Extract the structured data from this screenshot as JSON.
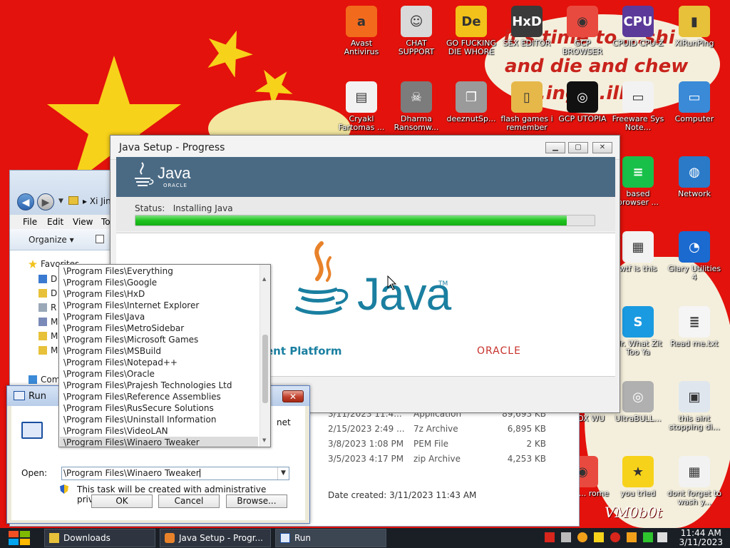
{
  "desktop": {
    "cloud_text": [
      "it's time to ...shi",
      "and die and chew",
      "...ing ...illi..."
    ],
    "watermark": "VM0b0t",
    "icons": [
      {
        "name": "avast-antivirus-icon",
        "label": "Avast Antivirus",
        "color": "#f26b1d",
        "glyph": "a"
      },
      {
        "name": "chat-support-icon",
        "label": "CHAT SUPPORT",
        "color": "#d9d9d9",
        "glyph": "☺"
      },
      {
        "name": "go-fucking-die-whore-icon",
        "label": "GO FUCKING DIE WHORE",
        "color": "#f2c21a",
        "glyph": "De"
      },
      {
        "name": "sex-editor-icon",
        "label": "SEX EDITOR",
        "color": "#3a3a3a",
        "glyph": "HxD"
      },
      {
        "name": "gcp-browser-icon",
        "label": "GCP BROWSER",
        "color": "#e94a3f",
        "glyph": "◉"
      },
      {
        "name": "cpuid-cpu-z-icon",
        "label": "CPUID CPU-Z",
        "color": "#5b3a9a",
        "glyph": "CPU"
      },
      {
        "name": "xirunping-icon",
        "label": "XiRunPing",
        "color": "#e8c13a",
        "glyph": "▮"
      },
      {
        "name": "cryakl-fartomas-icon",
        "label": "Cryakl Fartomas ...",
        "color": "#f2f2f2",
        "glyph": "▤"
      },
      {
        "name": "dharma-ransomw-icon",
        "label": "Dharma Ransomw...",
        "color": "#7c7c7c",
        "glyph": "☠"
      },
      {
        "name": "deeznutsp-icon",
        "label": "deeznutSp...",
        "color": "#9a9a9a",
        "glyph": "❐"
      },
      {
        "name": "flash-games-icon",
        "label": "flash games i remember",
        "color": "#e6b84a",
        "glyph": "▯"
      },
      {
        "name": "gcp-utopia-icon",
        "label": "GCP UTOPIA",
        "color": "#111111",
        "glyph": "◎"
      },
      {
        "name": "freeware-sys-note-icon",
        "label": "Freeware Sys Note...",
        "color": "#f2f2f2",
        "glyph": "▭"
      },
      {
        "name": "computer-icon",
        "label": "Computer",
        "color": "#3a8ad8",
        "glyph": "▭"
      },
      {
        "name": "based-browser-icon",
        "label": "based browser ...",
        "color": "#18c04a",
        "glyph": "≡"
      },
      {
        "name": "network-icon",
        "label": "Network",
        "color": "#2a7ac8",
        "glyph": "◍"
      },
      {
        "name": "wtf-is-this-icon",
        "label": "wtf is this",
        "color": "#f2f2f2",
        "glyph": "▦"
      },
      {
        "name": "glary-utilities-icon",
        "label": "Glary Utilities 4",
        "color": "#1a6ad0",
        "glyph": "◔"
      },
      {
        "name": "skype-icon",
        "label": "Mr. What Zit Too Ya",
        "color": "#1a9ae0",
        "glyph": "S"
      },
      {
        "name": "read-me-txt-icon",
        "label": "Read me.txt",
        "color": "#f5f5f5",
        "glyph": "≣"
      },
      {
        "name": "sexy-fox-wu-icon",
        "label": "XY FOX WU",
        "color": "#d03020",
        "glyph": "✦"
      },
      {
        "name": "ultrabull-icon",
        "label": "UltraBULL...",
        "color": "#b0b0b0",
        "glyph": "◎"
      },
      {
        "name": "this-aint-stopping-icon",
        "label": "this aint stopping di...",
        "color": "#dfe6ee",
        "glyph": "▣"
      },
      {
        "name": "chrome-icon",
        "label": "...mm... rome",
        "color": "#e94a3f",
        "glyph": "◉"
      },
      {
        "name": "you-tried-icon",
        "label": "you tried",
        "color": "#f7d21a",
        "glyph": "★"
      },
      {
        "name": "dont-forget-icon",
        "label": "dont forget to wash y...",
        "color": "#f2f2f2",
        "glyph": "▦"
      }
    ]
  },
  "explorer": {
    "breadcrumb": "Xi Jin",
    "menu": [
      "File",
      "Edit",
      "View",
      "To"
    ],
    "organize_label": "Organize",
    "nav": {
      "favorites": "Favorites",
      "items": [
        "D",
        "D",
        "R",
        "M",
        "M",
        "M"
      ],
      "computer": "Com"
    },
    "files": [
      {
        "date": "3/11/2023 11:4...",
        "type": "Application",
        "size": "89,693 KB"
      },
      {
        "date": "2/15/2023 2:49 ...",
        "type": "7z Archive",
        "size": "6,895 KB"
      },
      {
        "date": "3/8/2023 1:08 PM",
        "type": "PEM File",
        "size": "2 KB"
      },
      {
        "date": "3/5/2023 4:17 PM",
        "type": "zip Archive",
        "size": "4,253 KB"
      }
    ],
    "details": {
      "label": "Date created:",
      "value": "3/11/2023 11:43 AM"
    }
  },
  "java_dialog": {
    "title": "Java Setup - Progress",
    "status_label": "Status:",
    "status_value": "Installing Java",
    "progress": 0.94,
    "logo_text": "Java",
    "logo_sub": "ORACLE",
    "platform_text": "ent Platform",
    "oracle_text": "ORACLE",
    "colors": {
      "banner": "#4a6a84",
      "progress": "#1ec41e",
      "java_blue": "#1a7fa0",
      "java_orange": "#e8822a",
      "oracle_red": "#c7312a"
    }
  },
  "run_dialog": {
    "title": "Run",
    "description_partial": "net",
    "open_label": "Open:",
    "open_value": "\\Program Files\\Winaero Tweaker",
    "admin_note": "This task will be created with administrative privileges.",
    "buttons": {
      "ok": "OK",
      "cancel": "Cancel",
      "browse": "Browse..."
    }
  },
  "autocomplete": {
    "items": [
      "\\Program Files\\Everything",
      "\\Program Files\\Google",
      "\\Program Files\\HxD",
      "\\Program Files\\Internet Explorer",
      "\\Program Files\\Java",
      "\\Program Files\\MetroSidebar",
      "\\Program Files\\Microsoft Games",
      "\\Program Files\\MSBuild",
      "\\Program Files\\Notepad++",
      "\\Program Files\\Oracle",
      "\\Program Files\\Prajesh Technologies Ltd",
      "\\Program Files\\Reference Assemblies",
      "\\Program Files\\RusSecure Solutions",
      "\\Program Files\\Uninstall Information",
      "\\Program Files\\VideoLAN",
      "\\Program Files\\Winaero Tweaker"
    ],
    "selected_index": 15
  },
  "taskbar": {
    "items": [
      {
        "name": "taskbar-downloads",
        "label": "Downloads"
      },
      {
        "name": "taskbar-java-setup",
        "label": "Java Setup - Progr..."
      },
      {
        "name": "taskbar-run",
        "label": "Run"
      }
    ],
    "clock": {
      "time": "11:44 AM",
      "date": "3/11/2023"
    }
  }
}
